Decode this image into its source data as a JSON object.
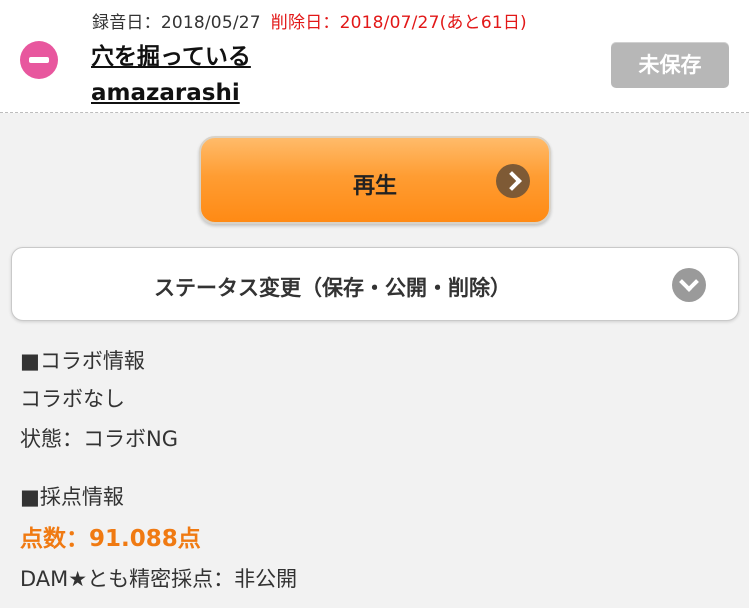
{
  "header": {
    "recorded_label": "録音日：",
    "recorded_date": "2018/05/27",
    "delete_label": "削除日：",
    "delete_date": "2018/07/27(あと61日)",
    "song_title": "穴を掘っている",
    "artist": "amazarashi",
    "save_button": "未保存"
  },
  "actions": {
    "play_label": "再生",
    "status_label": "ステータス変更（保存・公開・削除）"
  },
  "collab": {
    "heading": "■コラボ情報",
    "value": "コラボなし",
    "state": "状態：コラボNG"
  },
  "scoring": {
    "heading": "■採点情報",
    "score": "点数：91.088点",
    "dam_tomo": "DAM★とも精密採点：非公開"
  },
  "colors": {
    "accent_orange": "#ff9d33",
    "delete_red": "#e21818",
    "remove_pink": "#e8579e",
    "score_orange": "#f07a12"
  }
}
